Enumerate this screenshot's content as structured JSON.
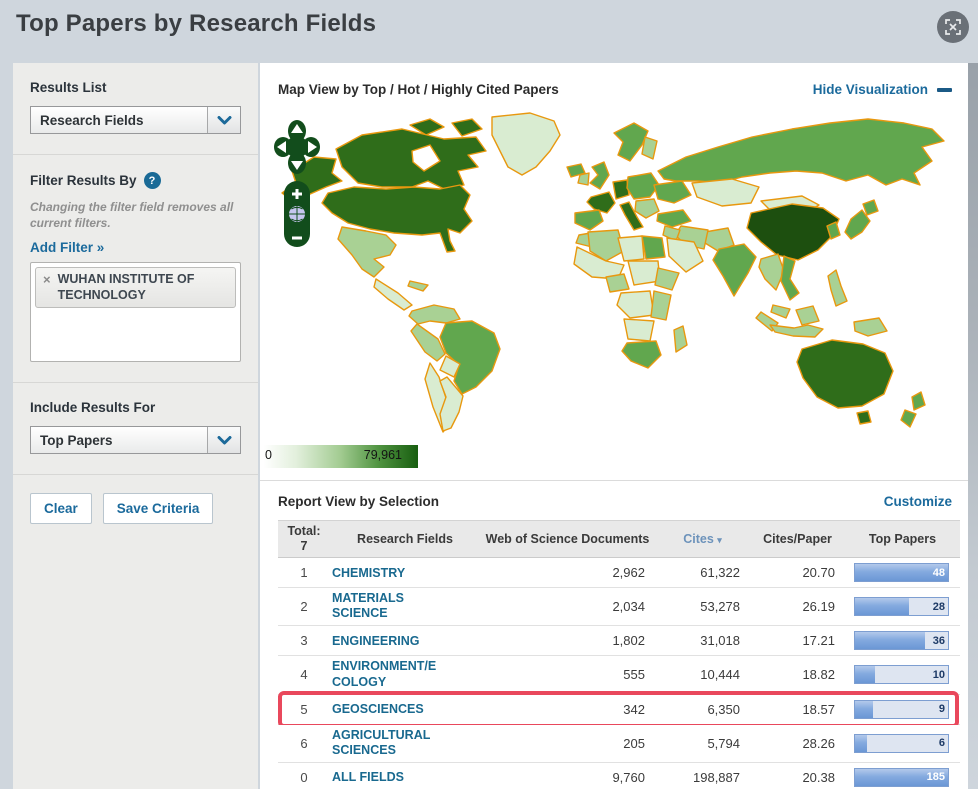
{
  "page": {
    "title": "Top Papers by Research Fields"
  },
  "icons": {
    "close": "×",
    "help": "?",
    "sort_desc": "▾"
  },
  "colors": {
    "link_blue": "#1b6a9c",
    "field_link": "#19698f",
    "sorted_header": "#6d93bb",
    "highlight_red": "#e9485c",
    "bar_fill": "#6b97d5",
    "bar_track": "#dee5f1",
    "map_border_orange": "#e8980f",
    "map_greens": [
      "#eaf4e4",
      "#d9ecd1",
      "#a9d194",
      "#61a74e",
      "#2f6d1a",
      "#1d4f0f"
    ]
  },
  "sidebar": {
    "results_list_label": "Results List",
    "results_list_value": "Research Fields",
    "filter_heading": "Filter Results By",
    "filter_note": "Changing the filter field removes all current filters.",
    "add_filter_label": "Add Filter »",
    "filter_chip": "WUHAN INSTITUTE OF TECHNOLOGY",
    "include_heading": "Include Results For",
    "include_value": "Top Papers",
    "clear_label": "Clear",
    "save_label": "Save Criteria"
  },
  "map": {
    "title": "Map View by Top / Hot / Highly Cited Papers",
    "hide_label": "Hide Visualization",
    "scale_min": "0",
    "scale_max": "79,961"
  },
  "report": {
    "title": "Report View by Selection",
    "customize_label": "Customize",
    "total_label": "Total:",
    "total_value": "7",
    "columns": [
      "Research Fields",
      "Web of Science Documents",
      "Cites",
      "Cites/Paper",
      "Top Papers"
    ],
    "sorted_column": "Cites",
    "rows": [
      {
        "rank": "1",
        "field": "CHEMISTRY",
        "docs": "2,962",
        "cites": "61,322",
        "cites_per_paper": "20.70",
        "top_papers": "48",
        "bar_pct": 100,
        "highlight": false
      },
      {
        "rank": "2",
        "field": "MATERIALS SCIENCE",
        "docs": "2,034",
        "cites": "53,278",
        "cites_per_paper": "26.19",
        "top_papers": "28",
        "bar_pct": 58,
        "highlight": false
      },
      {
        "rank": "3",
        "field": "ENGINEERING",
        "docs": "1,802",
        "cites": "31,018",
        "cites_per_paper": "17.21",
        "top_papers": "36",
        "bar_pct": 75,
        "highlight": false
      },
      {
        "rank": "4",
        "field": "ENVIRONMENT/ECOLOGY",
        "docs": "555",
        "cites": "10,444",
        "cites_per_paper": "18.82",
        "top_papers": "10",
        "bar_pct": 21,
        "highlight": false
      },
      {
        "rank": "5",
        "field": "GEOSCIENCES",
        "docs": "342",
        "cites": "6,350",
        "cites_per_paper": "18.57",
        "top_papers": "9",
        "bar_pct": 19,
        "highlight": true
      },
      {
        "rank": "6",
        "field": "AGRICULTURAL SCIENCES",
        "docs": "205",
        "cites": "5,794",
        "cites_per_paper": "28.26",
        "top_papers": "6",
        "bar_pct": 13,
        "highlight": false
      },
      {
        "rank": "0",
        "field": "ALL FIELDS",
        "docs": "9,760",
        "cites": "198,887",
        "cites_per_paper": "20.38",
        "top_papers": "185",
        "bar_pct": 100,
        "highlight": false
      }
    ]
  }
}
